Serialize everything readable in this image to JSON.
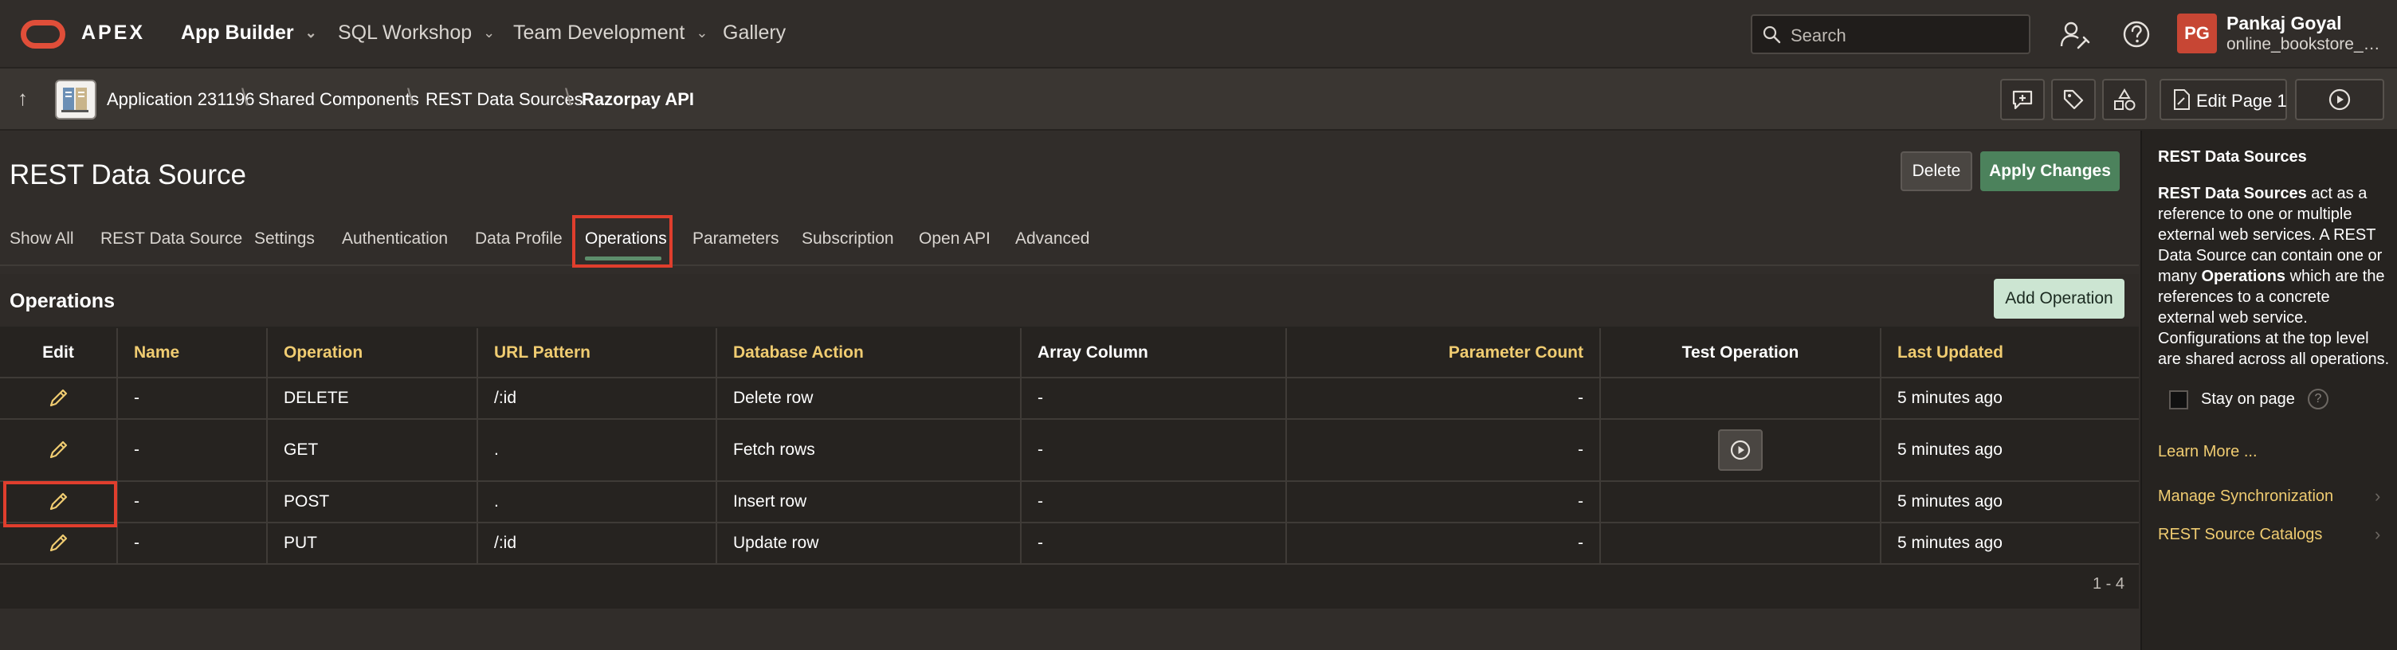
{
  "topbar": {
    "product": "APEX",
    "nav": [
      {
        "label": "App Builder",
        "active": true,
        "has_menu": true
      },
      {
        "label": "SQL Workshop",
        "active": false,
        "has_menu": true
      },
      {
        "label": "Team Development",
        "active": false,
        "has_menu": true
      },
      {
        "label": "Gallery",
        "active": false,
        "has_menu": false
      }
    ],
    "search_placeholder": "Search",
    "user": {
      "initials": "PG",
      "name": "Pankaj Goyal",
      "workspace": "online_bookstore_a..."
    }
  },
  "breadcrumb": {
    "items": [
      "Application 231196",
      "Shared Components",
      "REST Data Sources",
      "Razorpay API"
    ],
    "edit_page_label": "Edit Page 1"
  },
  "page": {
    "title": "REST Data Source",
    "delete_label": "Delete",
    "apply_label": "Apply Changes",
    "tabs": [
      "Show All",
      "REST Data Source",
      "Settings",
      "Authentication",
      "Data Profile",
      "Operations",
      "Parameters",
      "Subscription",
      "Open API",
      "Advanced"
    ],
    "active_tab": "Operations"
  },
  "operations": {
    "title": "Operations",
    "add_label": "Add Operation",
    "columns": [
      "Edit",
      "Name",
      "Operation",
      "URL Pattern",
      "Database Action",
      "Array Column",
      "Parameter Count",
      "Test Operation",
      "Last Updated"
    ],
    "rows": [
      {
        "name": "-",
        "operation": "DELETE",
        "url_pattern": "/:id",
        "database_action": "Delete row",
        "array_column": "-",
        "parameter_count": "-",
        "has_test": false,
        "last_updated": "5 minutes ago"
      },
      {
        "name": "-",
        "operation": "GET",
        "url_pattern": ".",
        "database_action": "Fetch rows",
        "array_column": "-",
        "parameter_count": "-",
        "has_test": true,
        "last_updated": "5 minutes ago"
      },
      {
        "name": "-",
        "operation": "POST",
        "url_pattern": ".",
        "database_action": "Insert row",
        "array_column": "-",
        "parameter_count": "-",
        "has_test": false,
        "last_updated": "5 minutes ago"
      },
      {
        "name": "-",
        "operation": "PUT",
        "url_pattern": "/:id",
        "database_action": "Update row",
        "array_column": "-",
        "parameter_count": "-",
        "has_test": false,
        "last_updated": "5 minutes ago"
      }
    ],
    "pagination": "1 - 4"
  },
  "help": {
    "title": "REST Data Sources",
    "p1_bold": "REST Data Sources",
    "p1_a": " act as a reference to one or multiple external web services. A REST Data Source can contain one or many ",
    "p1_bold2": "Operations",
    "p1_b": " which are the references to a concrete external web service. Configurations at the top level are shared across all operations.",
    "stay_label": "Stay on page",
    "stay_help": "?",
    "learn_more": "Learn More ...",
    "links": [
      "Manage Synchronization",
      "REST Source Catalogs"
    ]
  },
  "colors": {
    "accent_green": "#4c825c",
    "header_gold": "#f0cc71",
    "highlight_red": "#e03e2d",
    "avatar_red": "#c74634"
  }
}
